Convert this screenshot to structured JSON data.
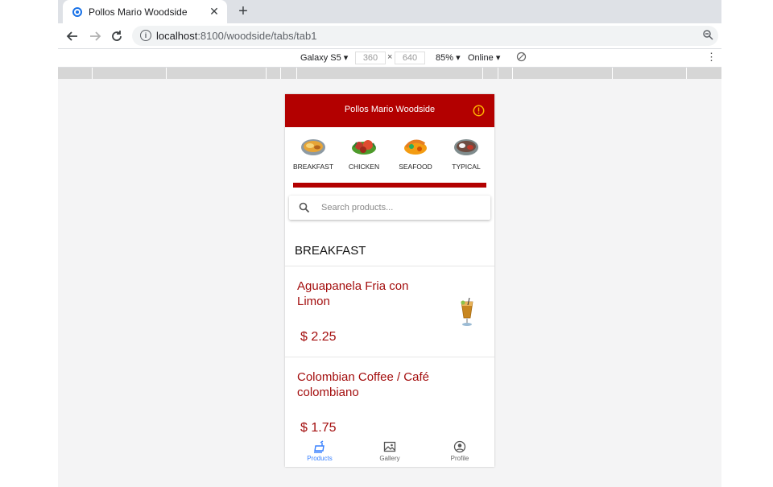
{
  "browser": {
    "tab_title": "Pollos Mario Woodside",
    "url_host": "localhost",
    "url_rest": ":8100/woodside/tabs/tab1"
  },
  "devtools": {
    "device": "Galaxy S5",
    "width": "360",
    "times": "×",
    "height": "640",
    "zoom": "85%",
    "network": "Online"
  },
  "app": {
    "title": "Pollos Mario Woodside",
    "accent": "#b30000",
    "categories": [
      {
        "label": "BREAKFAST"
      },
      {
        "label": "CHICKEN"
      },
      {
        "label": "SEAFOOD"
      },
      {
        "label": "TYPICAL"
      }
    ],
    "search_placeholder": "Search products...",
    "section_title": "BREAKFAST",
    "products": [
      {
        "name": "Aguapanela Fria con Limon",
        "price": "$ 2.25"
      },
      {
        "name": "Colombian Coffee / Café colombiano",
        "price": "$ 1.75"
      }
    ],
    "tabs": [
      {
        "label": "Products",
        "icon": "fastfood-icon",
        "active": true
      },
      {
        "label": "Gallery",
        "icon": "images-icon",
        "active": false
      },
      {
        "label": "Profile",
        "icon": "person-circle-icon",
        "active": false
      }
    ]
  }
}
